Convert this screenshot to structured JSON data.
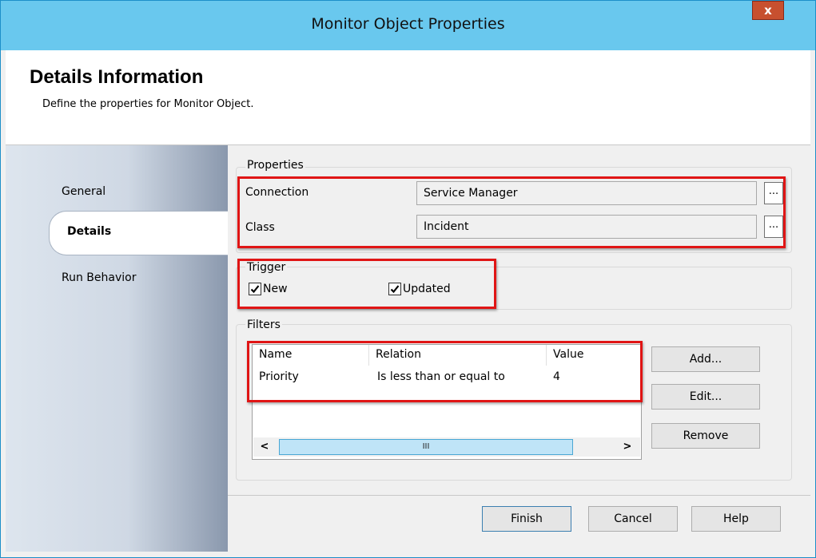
{
  "window": {
    "title": "Monitor Object Properties",
    "close_label": "x"
  },
  "header": {
    "title": "Details Information",
    "subtitle": "Define the properties for Monitor Object."
  },
  "nav": {
    "items": [
      {
        "label": "General"
      },
      {
        "label": "Details"
      },
      {
        "label": "Run Behavior"
      }
    ],
    "selected": "Details"
  },
  "properties": {
    "legend": "Properties",
    "connection_label": "Connection",
    "connection_value": "Service Manager",
    "class_label": "Class",
    "class_value": "Incident",
    "browse_label": "..."
  },
  "trigger": {
    "legend": "Trigger",
    "new_label": "New",
    "new_checked": true,
    "updated_label": "Updated",
    "updated_checked": true
  },
  "filters": {
    "legend": "Filters",
    "columns": [
      "Name",
      "Relation",
      "Value"
    ],
    "rows": [
      {
        "name": "Priority",
        "relation": "Is less than or equal to",
        "value": "4"
      }
    ],
    "scroll_left": "<",
    "scroll_right": ">",
    "scroll_thumb": "III",
    "add_label": "Add...",
    "edit_label": "Edit...",
    "remove_label": "Remove"
  },
  "footer": {
    "finish_label": "Finish",
    "cancel_label": "Cancel",
    "help_label": "Help"
  },
  "colors": {
    "titlebar": "#69c8ee",
    "close_button": "#c7502f",
    "highlight": "#e01515",
    "scroll_thumb": "#bfe4f7"
  }
}
